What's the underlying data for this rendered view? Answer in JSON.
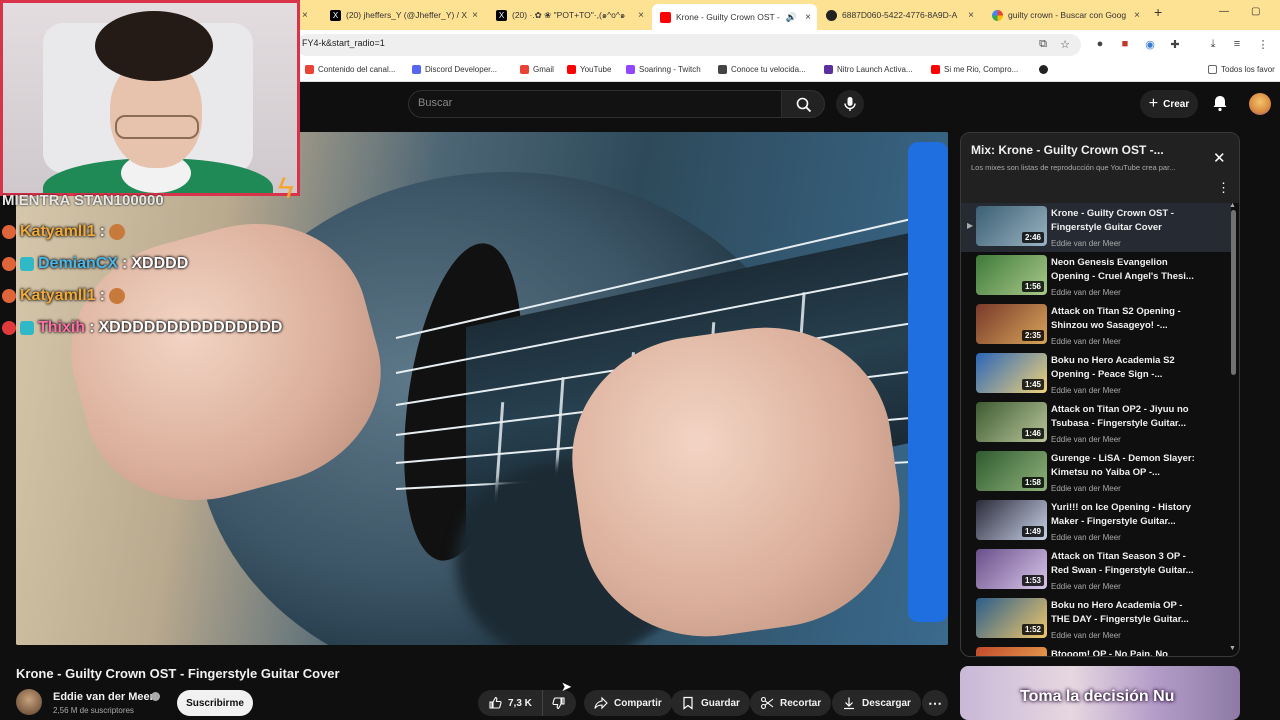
{
  "browser": {
    "tabs": [
      {
        "title": "(20) jheffers_Y (@Jheffer_Y) / X",
        "icon": "x-logo-icon"
      },
      {
        "title": "(20) ·.✿ ❀ \"POT+TO\"·,(๑^o^๑",
        "icon": "x-logo-icon"
      },
      {
        "title": "Krone - Guilty Crown OST -",
        "icon": "youtube-icon"
      },
      {
        "title": "6887D060-5422-4776-8A9D-A",
        "icon": "github-icon"
      },
      {
        "title": "guilty crown - Buscar con Goog",
        "icon": "google-icon"
      }
    ],
    "url": "FY4-k&start_radio=1",
    "bookmarks": [
      {
        "label": "Contenido del canal...",
        "color": "#ea4335"
      },
      {
        "label": "Discord Developer...",
        "color": "#5865f2"
      },
      {
        "label": "Gmail",
        "color": "#ea4335"
      },
      {
        "label": "YouTube",
        "color": "#ff0000"
      },
      {
        "label": "Soarinng - Twitch",
        "color": "#9146ff"
      },
      {
        "label": "Conoce tu velocida...",
        "color": "#444444"
      },
      {
        "label": "Nitro Launch Activa...",
        "color": "#5b2f9e"
      },
      {
        "label": "Si me Rio, Compro...",
        "color": "#ff0000"
      },
      {
        "label": "",
        "color": "#222222"
      },
      {
        "label": "Todos los favor",
        "color": "#666666"
      }
    ]
  },
  "header": {
    "search_placeholder": "Buscar",
    "create_label": "Crear"
  },
  "chat": {
    "partial_line": "MIENTRA STAN100000",
    "messages": [
      {
        "user": "Katyamll1",
        "sep": ":",
        "text": "",
        "color": "#f0a93a",
        "badges": 1
      },
      {
        "user": "DemianCX",
        "sep": ":",
        "text": "XDDDD",
        "color": "#4ab6e8",
        "badges": 2
      },
      {
        "user": "Katyamll1",
        "sep": ":",
        "text": "",
        "color": "#f0a93a",
        "badges": 1
      },
      {
        "user": "Thixih",
        "sep": ":",
        "text": "XDDDDDDDDDDDDDDD",
        "color": "#ff6fa8",
        "badges": 2
      }
    ]
  },
  "video": {
    "title": "Krone - Guilty Crown OST - Fingerstyle Guitar Cover",
    "channel": "Eddie van der Meer",
    "subscribers": "2,56 M de suscriptores",
    "subscribe_label": "Suscribirme",
    "likes": "7,3 K",
    "share_label": "Compartir",
    "save_label": "Guardar",
    "clip_label": "Recortar",
    "download_label": "Descargar"
  },
  "playlist": {
    "title": "Mix: Krone - Guilty Crown OST -...",
    "subtitle": "Los mixes son listas de reproducción que YouTube crea par...",
    "items": [
      {
        "title": "Krone - Guilty Crown OST - Fingerstyle Guitar Cover",
        "channel": "Eddie van der Meer",
        "duration": "2:46",
        "active": true,
        "thumb": [
          "#3b5f73",
          "#9ab3c2"
        ]
      },
      {
        "title": "Neon Genesis Evangelion Opening - Cruel Angel's Thesi...",
        "channel": "Eddie van der Meer",
        "duration": "1:56",
        "active": false,
        "thumb": [
          "#3f7a3a",
          "#a9c98a"
        ]
      },
      {
        "title": "Attack on Titan S2 Opening - Shinzou wo Sasageyo! -...",
        "channel": "Eddie van der Meer",
        "duration": "2:35",
        "active": false,
        "thumb": [
          "#7a3a2a",
          "#d6a45a"
        ]
      },
      {
        "title": "Boku no Hero Academia S2 Opening - Peace Sign -...",
        "channel": "Eddie van der Meer",
        "duration": "1:45",
        "active": false,
        "thumb": [
          "#2a66b8",
          "#f0d27a"
        ]
      },
      {
        "title": "Attack on Titan OP2 - Jiyuu no Tsubasa - Fingerstyle Guitar...",
        "channel": "Eddie van der Meer",
        "duration": "1:46",
        "active": false,
        "thumb": [
          "#3e5a32",
          "#b9c79a"
        ]
      },
      {
        "title": "Gurenge - LiSA - Demon Slayer: Kimetsu no Yaiba OP -...",
        "channel": "Eddie van der Meer",
        "duration": "1:58",
        "active": false,
        "thumb": [
          "#2f5a30",
          "#8fb27a"
        ]
      },
      {
        "title": "Yuri!!! on Ice Opening - History Maker - Fingerstyle Guitar...",
        "channel": "Eddie van der Meer",
        "duration": "1:49",
        "active": false,
        "thumb": [
          "#2b2b3a",
          "#c9d2e8"
        ]
      },
      {
        "title": "Attack on Titan Season 3 OP - Red Swan - Fingerstyle Guitar...",
        "channel": "Eddie van der Meer",
        "duration": "1:53",
        "active": false,
        "thumb": [
          "#6a4f8a",
          "#d9c6ea"
        ]
      },
      {
        "title": "Boku no Hero Academia OP - THE DAY - Fingerstyle Guitar...",
        "channel": "Eddie van der Meer",
        "duration": "1:52",
        "active": false,
        "thumb": [
          "#2b5d8a",
          "#f2c86a"
        ]
      },
      {
        "title": "Btooom! OP - No Pain, No",
        "channel": "",
        "duration": "",
        "active": false,
        "thumb": [
          "#c04a2a",
          "#f2b25a"
        ]
      }
    ]
  },
  "ad": {
    "text": "Toma la decisión Nu"
  }
}
